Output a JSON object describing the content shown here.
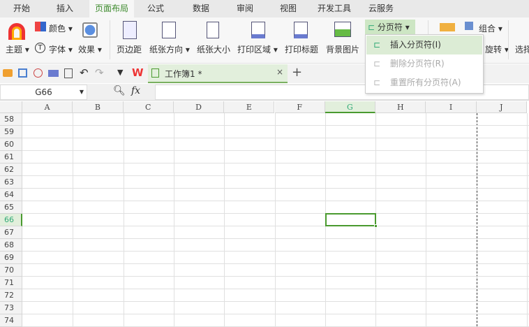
{
  "tabs": [
    "开始",
    "插入",
    "页面布局",
    "公式",
    "数据",
    "审阅",
    "视图",
    "开发工具",
    "云服务"
  ],
  "active_tab": "页面布局",
  "ribbon": {
    "theme": "主题",
    "color": "颜色",
    "font": "字体",
    "effect": "效果",
    "margins": "页边距",
    "orientation": "纸张方向",
    "size": "纸张大小",
    "print_area": "打印区域",
    "print_titles": "打印标题",
    "background": "背景图片",
    "page_break": "分页符",
    "group": "组合",
    "rotate": "旋转",
    "select": "选择"
  },
  "page_break_menu": [
    {
      "label": "插入分页符(I)",
      "enabled": true
    },
    {
      "label": "删除分页符(R)",
      "enabled": false
    },
    {
      "label": "重置所有分页符(A)",
      "enabled": false
    }
  ],
  "doc_tab": {
    "title": "工作簿1 *",
    "close": "×",
    "add": "+"
  },
  "formula_bar": {
    "name_box": "G66",
    "fx": "fx",
    "value": ""
  },
  "columns": [
    "A",
    "B",
    "C",
    "D",
    "E",
    "F",
    "G",
    "H",
    "I",
    "J"
  ],
  "rows": [
    "58",
    "59",
    "60",
    "61",
    "62",
    "63",
    "64",
    "65",
    "66",
    "67",
    "68",
    "69",
    "70",
    "71",
    "72",
    "73",
    "74"
  ],
  "selected_cell": {
    "column": "G",
    "row": "66"
  },
  "accent": "#4a9a2f"
}
